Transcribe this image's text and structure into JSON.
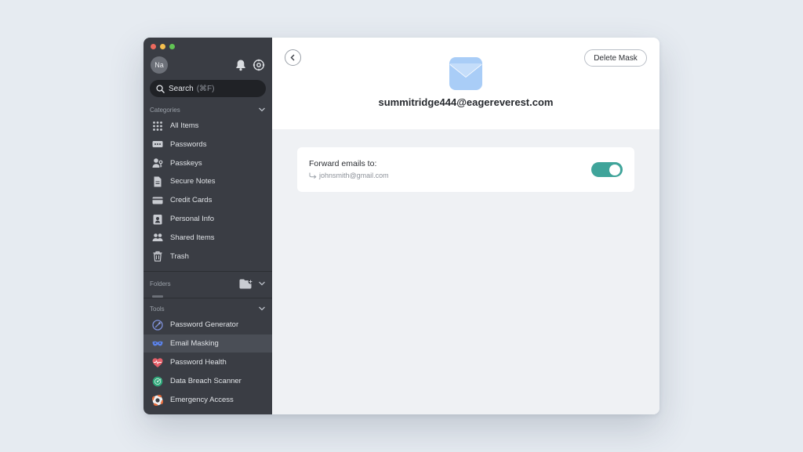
{
  "window": {
    "avatar_initials": "Na",
    "icons": [
      "bell-icon",
      "gear-icon"
    ]
  },
  "search": {
    "label": "Search",
    "shortcut": "(⌘F)"
  },
  "sidebar": {
    "categories_heading": "Categories",
    "categories": [
      {
        "label": "All Items",
        "icon": "grid-icon"
      },
      {
        "label": "Passwords",
        "icon": "password-icon"
      },
      {
        "label": "Passkeys",
        "icon": "passkey-icon"
      },
      {
        "label": "Secure Notes",
        "icon": "note-icon"
      },
      {
        "label": "Credit Cards",
        "icon": "credit-card-icon"
      },
      {
        "label": "Personal Info",
        "icon": "id-card-icon"
      },
      {
        "label": "Shared Items",
        "icon": "people-icon"
      },
      {
        "label": "Trash",
        "icon": "trash-icon"
      }
    ],
    "folders_heading": "Folders",
    "tools_heading": "Tools",
    "tools": [
      {
        "label": "Password Generator",
        "icon": "generator-icon"
      },
      {
        "label": "Email Masking",
        "icon": "mask-icon",
        "active": true
      },
      {
        "label": "Password Health",
        "icon": "heart-pulse-icon"
      },
      {
        "label": "Data Breach Scanner",
        "icon": "radar-icon"
      },
      {
        "label": "Emergency Access",
        "icon": "lifebuoy-icon"
      }
    ]
  },
  "header": {
    "delete_label": "Delete Mask",
    "email": "summitridge444@eagereverest.com"
  },
  "forward": {
    "label": "Forward emails to:",
    "value": "johnsmith@gmail.com",
    "enabled": true
  },
  "colors": {
    "sidebar_bg": "#3a3d44",
    "accent_toggle": "#3fa49a",
    "mask_icon_blue": "#a9cdf7"
  }
}
